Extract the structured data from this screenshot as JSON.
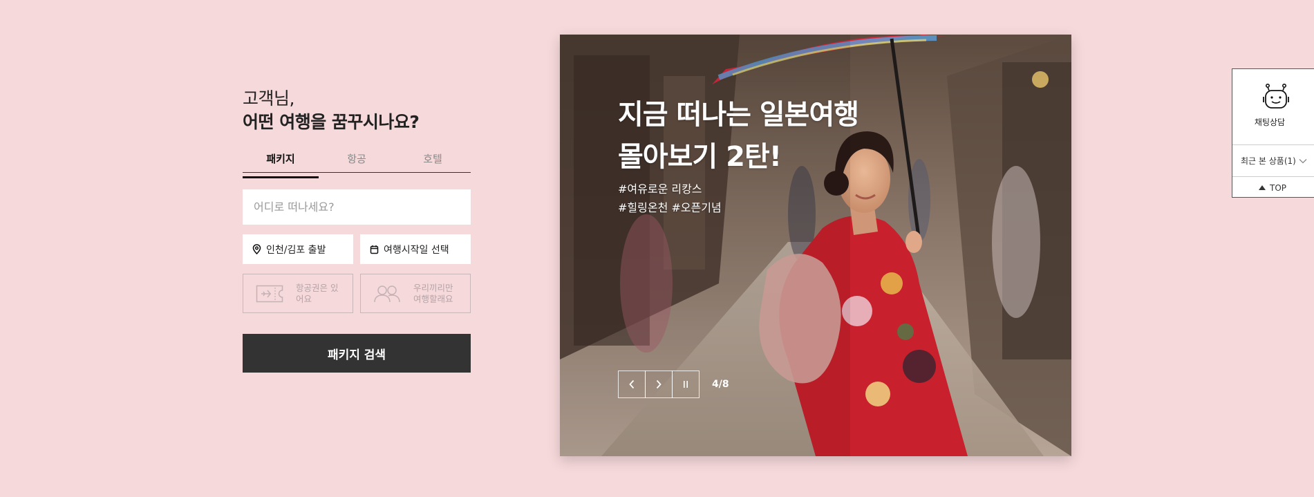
{
  "search": {
    "greeting_line1": "고객님,",
    "greeting_line2": "어떤 여행을 꿈꾸시나요?",
    "tabs": [
      {
        "label": "패키지",
        "active": true
      },
      {
        "label": "항공",
        "active": false
      },
      {
        "label": "호텔",
        "active": false
      }
    ],
    "destination_placeholder": "어디로 떠나세요?",
    "departure": {
      "label": "인천/김포 출발",
      "icon": "location-pin-icon"
    },
    "start_date": {
      "label": "여행시작일 선택",
      "icon": "calendar-icon"
    },
    "toggles": [
      {
        "label": "항공권은 있어요",
        "icon": "flight-ticket-icon"
      },
      {
        "label": "우리끼리만 여행할래요",
        "icon": "group-people-icon"
      }
    ],
    "submit_label": "패키지 검색"
  },
  "banner": {
    "title_line1": "지금 떠나는 일본여행",
    "title_line2": "몰아보기 2탄!",
    "tags_line1": "#여유로운 리캉스",
    "tags_line2": "#힐링온천 #오픈기념",
    "counter": "4/8",
    "controls": [
      "prev-icon",
      "next-icon",
      "pause-icon"
    ]
  },
  "rail": {
    "chat_label": "채팅상담",
    "recent_label": "최근 본 상품(1)",
    "top_label": "TOP"
  },
  "colors": {
    "page_bg": "#f6d9db",
    "button_dark": "#333333",
    "parasol_red": "#d62a3c",
    "kimono_red": "#c8202c"
  }
}
